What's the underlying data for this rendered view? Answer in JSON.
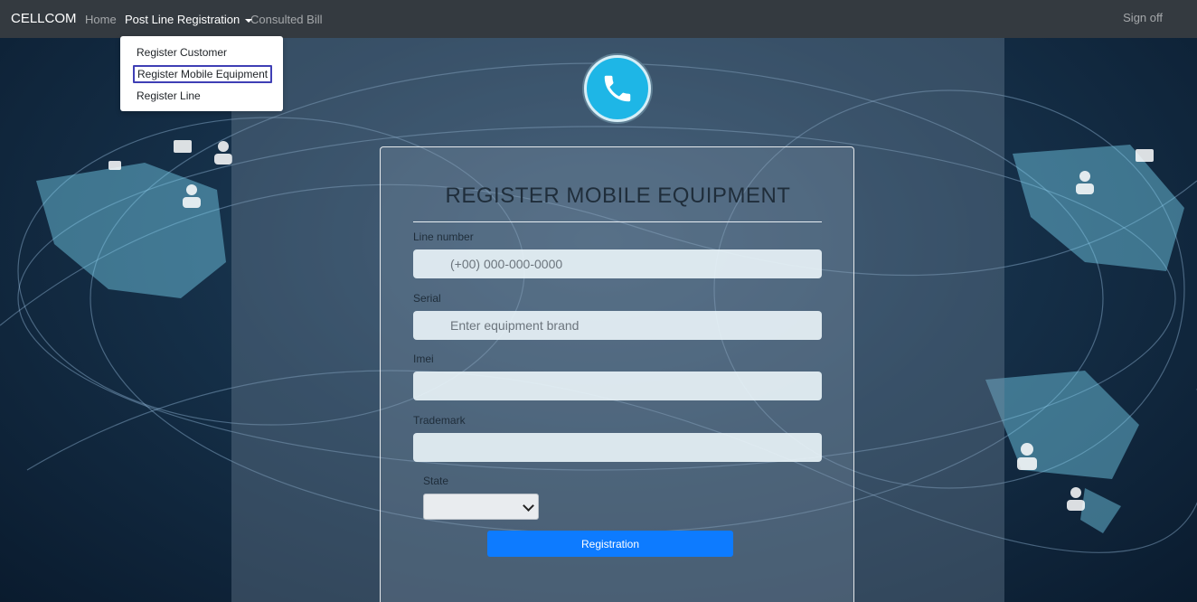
{
  "navbar": {
    "brand": "CELLCOM",
    "home": "Home",
    "post_line_registration": "Post Line Registration",
    "consulted_bill": "Consulted Bill",
    "sign_off": "Sign off"
  },
  "dropdown": {
    "items": [
      "Register Customer",
      "Register Mobile Equipment",
      "Register Line"
    ]
  },
  "form": {
    "title": "REGISTER MOBILE EQUIPMENT",
    "line_number_label": "Line number",
    "line_number_placeholder": "(+00) 000-000-0000",
    "serial_label": "Serial",
    "serial_placeholder": "Enter equipment brand",
    "imei_label": "Imei",
    "imei_value": "",
    "trademark_label": "Trademark",
    "trademark_value": "",
    "state_label": "State",
    "state_value": "",
    "submit": "Registration"
  },
  "icons": {
    "logo": "phone-icon"
  },
  "colors": {
    "navbar": "#343a40",
    "primary_button": "#0d7bff",
    "logo": "#1eb6e6"
  }
}
